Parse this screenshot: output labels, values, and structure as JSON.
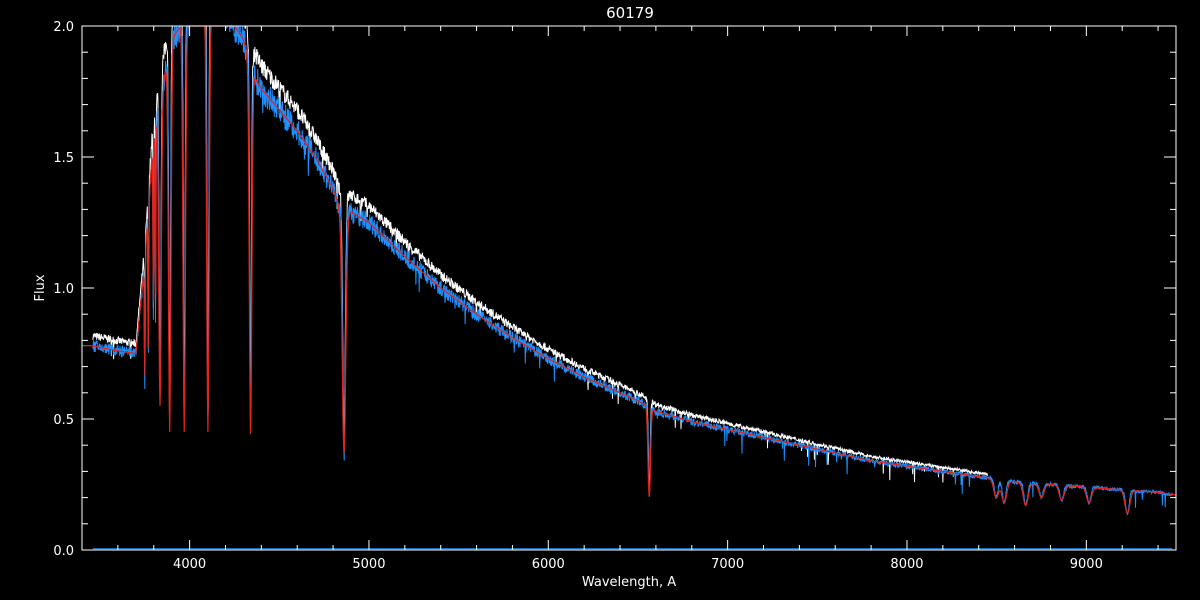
{
  "chart_data": {
    "type": "line",
    "title": "60179",
    "xlabel": "Wavelength, A",
    "ylabel": "Flux",
    "xlim": [
      3400,
      9500
    ],
    "ylim": [
      0.0,
      2.0
    ],
    "x_ticks": [
      4000,
      5000,
      6000,
      7000,
      8000,
      9000
    ],
    "x_tick_labels": [
      "4000",
      "5000",
      "6000",
      "7000",
      "8000",
      "9000"
    ],
    "y_ticks": [
      0.0,
      0.5,
      1.0,
      1.5,
      2.0
    ],
    "y_tick_labels": [
      "0.0",
      "0.5",
      "1.0",
      "1.5",
      "2.0"
    ],
    "grid": false,
    "colors": {
      "background": "#000000",
      "axes": "#ffffff",
      "white_series": "#ffffff",
      "blue_series": "#1e90ff",
      "red_series": "#e0241b"
    },
    "continuum": {
      "x": [
        3450,
        3600,
        3700,
        3750,
        3800,
        3900,
        4000,
        4100,
        4200,
        4300,
        4350,
        4400,
        4500,
        4600,
        4700,
        4800,
        4850,
        4900,
        5000,
        5200,
        5400,
        5600,
        5800,
        6000,
        6200,
        6400,
        6500,
        6600,
        6800,
        7000,
        7200,
        7400,
        7600,
        7800,
        8000,
        8200,
        8400,
        8600,
        8800,
        9000,
        9200,
        9400,
        9500
      ],
      "y": [
        0.78,
        0.76,
        0.75,
        1.1,
        1.6,
        1.95,
        2.05,
        2.1,
        2.05,
        1.95,
        1.82,
        1.76,
        1.68,
        1.6,
        1.5,
        1.38,
        1.28,
        1.29,
        1.25,
        1.12,
        1.0,
        0.9,
        0.81,
        0.73,
        0.66,
        0.6,
        0.57,
        0.53,
        0.49,
        0.46,
        0.43,
        0.4,
        0.37,
        0.34,
        0.32,
        0.3,
        0.28,
        0.26,
        0.25,
        0.24,
        0.23,
        0.22,
        0.21
      ]
    },
    "absorption_lines": [
      {
        "x": 3835,
        "min": 0.55
      },
      {
        "x": 3889,
        "min": 0.45
      },
      {
        "x": 3970,
        "min": 0.45
      },
      {
        "x": 4102,
        "min": 0.45
      },
      {
        "x": 4340,
        "min": 0.43
      },
      {
        "x": 4861,
        "min": 0.37
      },
      {
        "x": 6563,
        "min": 0.2
      },
      {
        "x": 8498,
        "min": 0.2
      },
      {
        "x": 8542,
        "min": 0.18
      },
      {
        "x": 8662,
        "min": 0.17
      },
      {
        "x": 8750,
        "min": 0.2
      },
      {
        "x": 8863,
        "min": 0.19
      },
      {
        "x": 9015,
        "min": 0.18
      },
      {
        "x": 9229,
        "min": 0.14
      }
    ],
    "series": [
      {
        "name": "",
        "color": "white"
      },
      {
        "name": "",
        "color": "blue"
      },
      {
        "name": "",
        "color": "red"
      }
    ]
  }
}
